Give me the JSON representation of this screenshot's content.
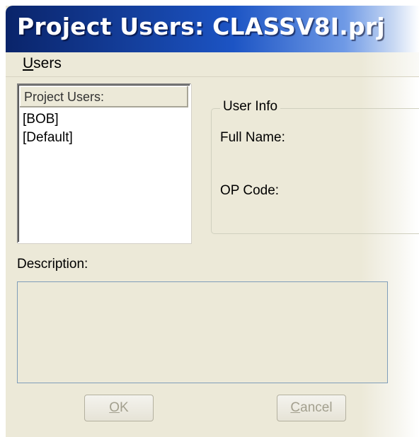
{
  "window": {
    "title": "Project Users: CLASSV8I.prj"
  },
  "menu": {
    "users_label": "Users",
    "users_accel": "U",
    "users_rest": "sers"
  },
  "list": {
    "header": "Project Users:",
    "items": [
      "[BOB]",
      "[Default]"
    ]
  },
  "user_info": {
    "title": "User Info",
    "full_name_label": "Full Name:",
    "op_code_label": "OP Code:"
  },
  "description": {
    "label": "Description:",
    "value": ""
  },
  "buttons": {
    "ok": {
      "accel": "O",
      "rest": "K",
      "enabled": false
    },
    "cancel": {
      "prefix": "",
      "accel": "C",
      "rest": "ancel",
      "enabled": false
    }
  },
  "colors": {
    "title_gradient_start": "#0a246a",
    "title_gradient_mid": "#1c54c4",
    "dialog_bg": "#ece9d8"
  }
}
